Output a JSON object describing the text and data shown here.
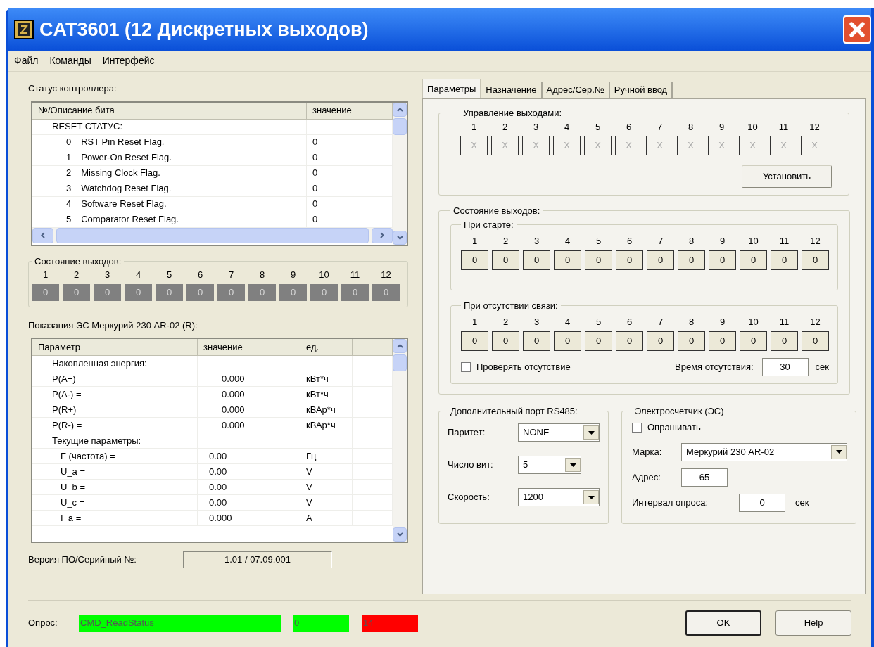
{
  "window": {
    "title": "CAT3601 (12 Дискретных выходов)"
  },
  "menu": [
    "Файл",
    "Команды",
    "Интерфейс"
  ],
  "controller_status": {
    "label": "Статус контроллера:",
    "columns": [
      "№/Описание бита",
      "значение"
    ],
    "groups": [
      {
        "label": "RESET СТАТУС:",
        "children": [
          {
            "number": "0",
            "description": "RST Pin Reset Flag.",
            "value": "0"
          },
          {
            "number": "1",
            "description": "Power-On Reset Flag.",
            "value": "0"
          },
          {
            "number": "2",
            "description": "Missing Clock Flag.",
            "value": "0"
          },
          {
            "number": "3",
            "description": "Watchdog Reset Flag.",
            "value": "0"
          },
          {
            "number": "4",
            "description": "Software Reset Flag.",
            "value": "0"
          },
          {
            "number": "5",
            "description": "Comparator Reset Flag.",
            "value": "0"
          }
        ]
      }
    ]
  },
  "output_state": {
    "label": "Состояние выходов:",
    "outputs": [
      {
        "number": "1",
        "value": "0"
      },
      {
        "number": "2",
        "value": "0"
      },
      {
        "number": "3",
        "value": "0"
      },
      {
        "number": "4",
        "value": "0"
      },
      {
        "number": "5",
        "value": "0"
      },
      {
        "number": "6",
        "value": "0"
      },
      {
        "number": "7",
        "value": "0"
      },
      {
        "number": "8",
        "value": "0"
      },
      {
        "number": "9",
        "value": "0"
      },
      {
        "number": "10",
        "value": "0"
      },
      {
        "number": "11",
        "value": "0"
      },
      {
        "number": "12",
        "value": "0"
      }
    ]
  },
  "meter_readings": {
    "label": "Показания ЭС Меркурий 230 AR-02 (R):",
    "columns": [
      "Параметр",
      "значение",
      "ед."
    ],
    "groups": [
      {
        "label": "Накопленная энергия:",
        "kind": "energy",
        "children": [
          {
            "parameter": "P(A+) =",
            "value": "0.000",
            "unit": "кВт*ч"
          },
          {
            "parameter": "P(A-) =",
            "value": "0.000",
            "unit": "кВт*ч"
          },
          {
            "parameter": "P(R+) =",
            "value": "0.000",
            "unit": "кВАр*ч"
          },
          {
            "parameter": "P(R-) =",
            "value": "0.000",
            "unit": "кВАр*ч"
          }
        ]
      },
      {
        "label": "Текущие параметры:",
        "kind": "current",
        "children": [
          {
            "parameter": "F (частота) =",
            "value": "0.00",
            "unit": "Гц"
          },
          {
            "parameter": "U_a =",
            "value": "0.00",
            "unit": "V"
          },
          {
            "parameter": "U_b =",
            "value": "0.00",
            "unit": "V"
          },
          {
            "parameter": "U_c =",
            "value": "0.00",
            "unit": "V"
          },
          {
            "parameter": "I_a =",
            "value": "0.000",
            "unit": "A"
          }
        ]
      }
    ]
  },
  "firmware": {
    "label": "Версия ПО/Серийный №:",
    "value": "1.01 / 07.09.001"
  },
  "poll": {
    "label": "Опрос:",
    "indicators": [
      {
        "text": "CMD_ReadStatus",
        "color": "#00ff00"
      },
      {
        "text": "0",
        "color": "#00ff00"
      },
      {
        "text": "14",
        "color": "#ff0000"
      }
    ]
  },
  "tabs": [
    {
      "label": "Параметры",
      "selected": true
    },
    {
      "label": "Назначение",
      "selected": false
    },
    {
      "label": "Адрес/Сер.№",
      "selected": false
    },
    {
      "label": "Ручной ввод",
      "selected": false
    }
  ],
  "output_control": {
    "label": "Управление выходами:",
    "button": "Установить",
    "outputs": [
      {
        "number": "1",
        "value": "X"
      },
      {
        "number": "2",
        "value": "X"
      },
      {
        "number": "3",
        "value": "X"
      },
      {
        "number": "4",
        "value": "X"
      },
      {
        "number": "5",
        "value": "X"
      },
      {
        "number": "6",
        "value": "X"
      },
      {
        "number": "7",
        "value": "X"
      },
      {
        "number": "8",
        "value": "X"
      },
      {
        "number": "9",
        "value": "X"
      },
      {
        "number": "10",
        "value": "X"
      },
      {
        "number": "11",
        "value": "X"
      },
      {
        "number": "12",
        "value": "X"
      }
    ]
  },
  "output_states": {
    "label": "Состояние выходов:",
    "on_start": {
      "label": "При старте:",
      "outputs": [
        {
          "number": "1",
          "value": "0"
        },
        {
          "number": "2",
          "value": "0"
        },
        {
          "number": "3",
          "value": "0"
        },
        {
          "number": "4",
          "value": "0"
        },
        {
          "number": "5",
          "value": "0"
        },
        {
          "number": "6",
          "value": "0"
        },
        {
          "number": "7",
          "value": "0"
        },
        {
          "number": "8",
          "value": "0"
        },
        {
          "number": "9",
          "value": "0"
        },
        {
          "number": "10",
          "value": "0"
        },
        {
          "number": "11",
          "value": "0"
        },
        {
          "number": "12",
          "value": "0"
        }
      ]
    },
    "on_link_loss": {
      "label": "При отсутствии связи:",
      "outputs": [
        {
          "number": "1",
          "value": "0"
        },
        {
          "number": "2",
          "value": "0"
        },
        {
          "number": "3",
          "value": "0"
        },
        {
          "number": "4",
          "value": "0"
        },
        {
          "number": "5",
          "value": "0"
        },
        {
          "number": "6",
          "value": "0"
        },
        {
          "number": "7",
          "value": "0"
        },
        {
          "number": "8",
          "value": "0"
        },
        {
          "number": "9",
          "value": "0"
        },
        {
          "number": "10",
          "value": "0"
        },
        {
          "number": "11",
          "value": "0"
        },
        {
          "number": "12",
          "value": "0"
        }
      ],
      "check": {
        "label": "Проверять отсутствие",
        "checked": false
      },
      "timeout": {
        "label": "Время отсутствия:",
        "value": "30",
        "unit": "сек"
      }
    }
  },
  "rs485": {
    "label": "Дополнительный порт RS485:",
    "fields": [
      {
        "label": "Паритет:",
        "value": "NONE"
      },
      {
        "label": "Число вит:",
        "value": "5"
      },
      {
        "label": "Скорость:",
        "value": "1200"
      }
    ]
  },
  "meter": {
    "label": "Электросчетчик (ЭС)",
    "poll": {
      "label": "Опрашивать",
      "checked": false
    },
    "brand": {
      "label": "Марка:",
      "value": "Меркурий 230 AR-02"
    },
    "address": {
      "label": "Адрес:",
      "value": "65"
    },
    "interval": {
      "label": "Интервал опроса:",
      "value": "0",
      "unit": "сек"
    }
  },
  "buttons": [
    "OK",
    "Help"
  ]
}
